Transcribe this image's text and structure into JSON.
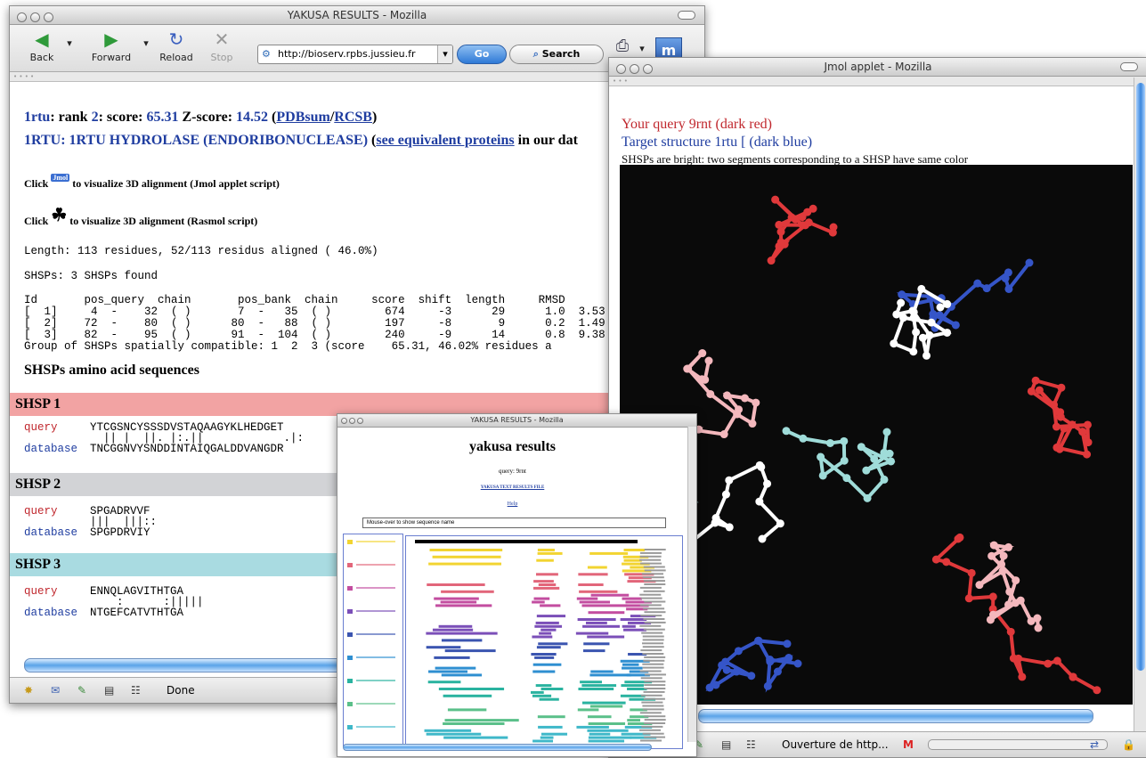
{
  "main": {
    "title": "YAKUSA RESULTS - Mozilla",
    "toolbar": {
      "back": "Back",
      "forward": "Forward",
      "reload": "Reload",
      "stop": "Stop",
      "url": "http://bioserv.rpbs.jussieu.fr",
      "go": "Go",
      "search": "Search"
    },
    "rank_line": {
      "id": "1rtu",
      "rank_label": ": rank ",
      "rank": "2",
      "score_label": ": score: ",
      "score": "65.31",
      "z_label": " Z-score: ",
      "zscore": "14.52",
      "open": " (",
      "pdbsum": "PDBsum",
      "slash": "/",
      "rcsb": "RCSB",
      "close": ")"
    },
    "desc_line": {
      "text": "1RTU: 1RTU HYDROLASE (ENDORIBONUCLEASE)",
      "open": " (",
      "link": "see equivalent proteins",
      "tail": " in our dat"
    },
    "click_jmol": {
      "pre": "Click",
      "icon_label": "Jmol",
      "post": "to visualize 3D alignment (Jmol applet script)"
    },
    "click_rasmol": {
      "pre": "Click",
      "post": "to visualize 3D alignment (Rasmol script)"
    },
    "length_line": "Length: 113 residues, 52/113 residus aligned ( 46.0%)",
    "shsps_line": "SHSPs: 3 SHSPs found",
    "table_block": "Id       pos_query  chain       pos_bank  chain     score  shift  length     RMSD\n[  1]     4  -    32  ( )       7  -   35  ( )        674     -3      29      1.0  3.53\n[  2]    72  -    80  ( )      80  -   88  ( )        197     -8       9      0.2  1.49\n[  3]    82  -    95  ( )      91  -  104  ( )        240     -9      14      0.8  9.38\nGroup of SHSPs spatially compatible: 1  2  3 (score    65.31, 46.02% residues a",
    "seq_header": "SHSPs amino acid sequences",
    "shsp": [
      {
        "title": "SHSP 1",
        "query_label": "query",
        "query_seq": "YTCGSNCYSSSDVSTAQAAGYKLHEDGET",
        "match": "  || |  ||. |:.||            .|:",
        "db_label": "database",
        "db_seq": "TNCGGNVYSNDDINTAIQGALDDVANGDR",
        "color": "#f2a3a3"
      },
      {
        "title": "SHSP 2",
        "query_label": "query",
        "query_seq": "SPGADRVVF",
        "match": "|||  |||::",
        "db_label": "database",
        "db_seq": "SPGPDRVIY",
        "color": "#d2d3d6"
      },
      {
        "title": "SHSP 3",
        "query_label": "query",
        "query_seq": "ENNQLAGVITHTGA",
        "match": "    :      :|||||",
        "db_label": "database",
        "db_seq": "NTGEFCATVTHTGA",
        "color": "#a9dbe1"
      }
    ],
    "status": "Done"
  },
  "jmol": {
    "title": "Jmol applet - Mozilla",
    "query_line": "Your query 9rnt (dark red)",
    "target_line": "Target structure 1rtu [ (dark blue)",
    "note_line": "SHSPs are bright: two segments corresponding to a SHSP have same color",
    "status": "Ouverture de http..."
  },
  "small": {
    "title": "YAKUSA RESULTS - Mozilla",
    "heading": "yakusa results",
    "query": "query: 9rnt",
    "link1": "YAKUSA TEXT RESULTS FILE",
    "help": "Help",
    "mouse_over": "Mouse-over to show sequence name"
  },
  "colors": {
    "accent_blue": "#1f3da0",
    "query_red": "#c0272d",
    "shsp1": "#f2a3a3",
    "shsp2": "#d2d3d6",
    "shsp3": "#a9dbe1",
    "jmol_bg": "#0a0a0a",
    "chain_red": "#e0393b",
    "chain_blue": "#3555c8",
    "chain_pink": "#f4b8bd",
    "chain_cyan": "#9fdcd9"
  }
}
